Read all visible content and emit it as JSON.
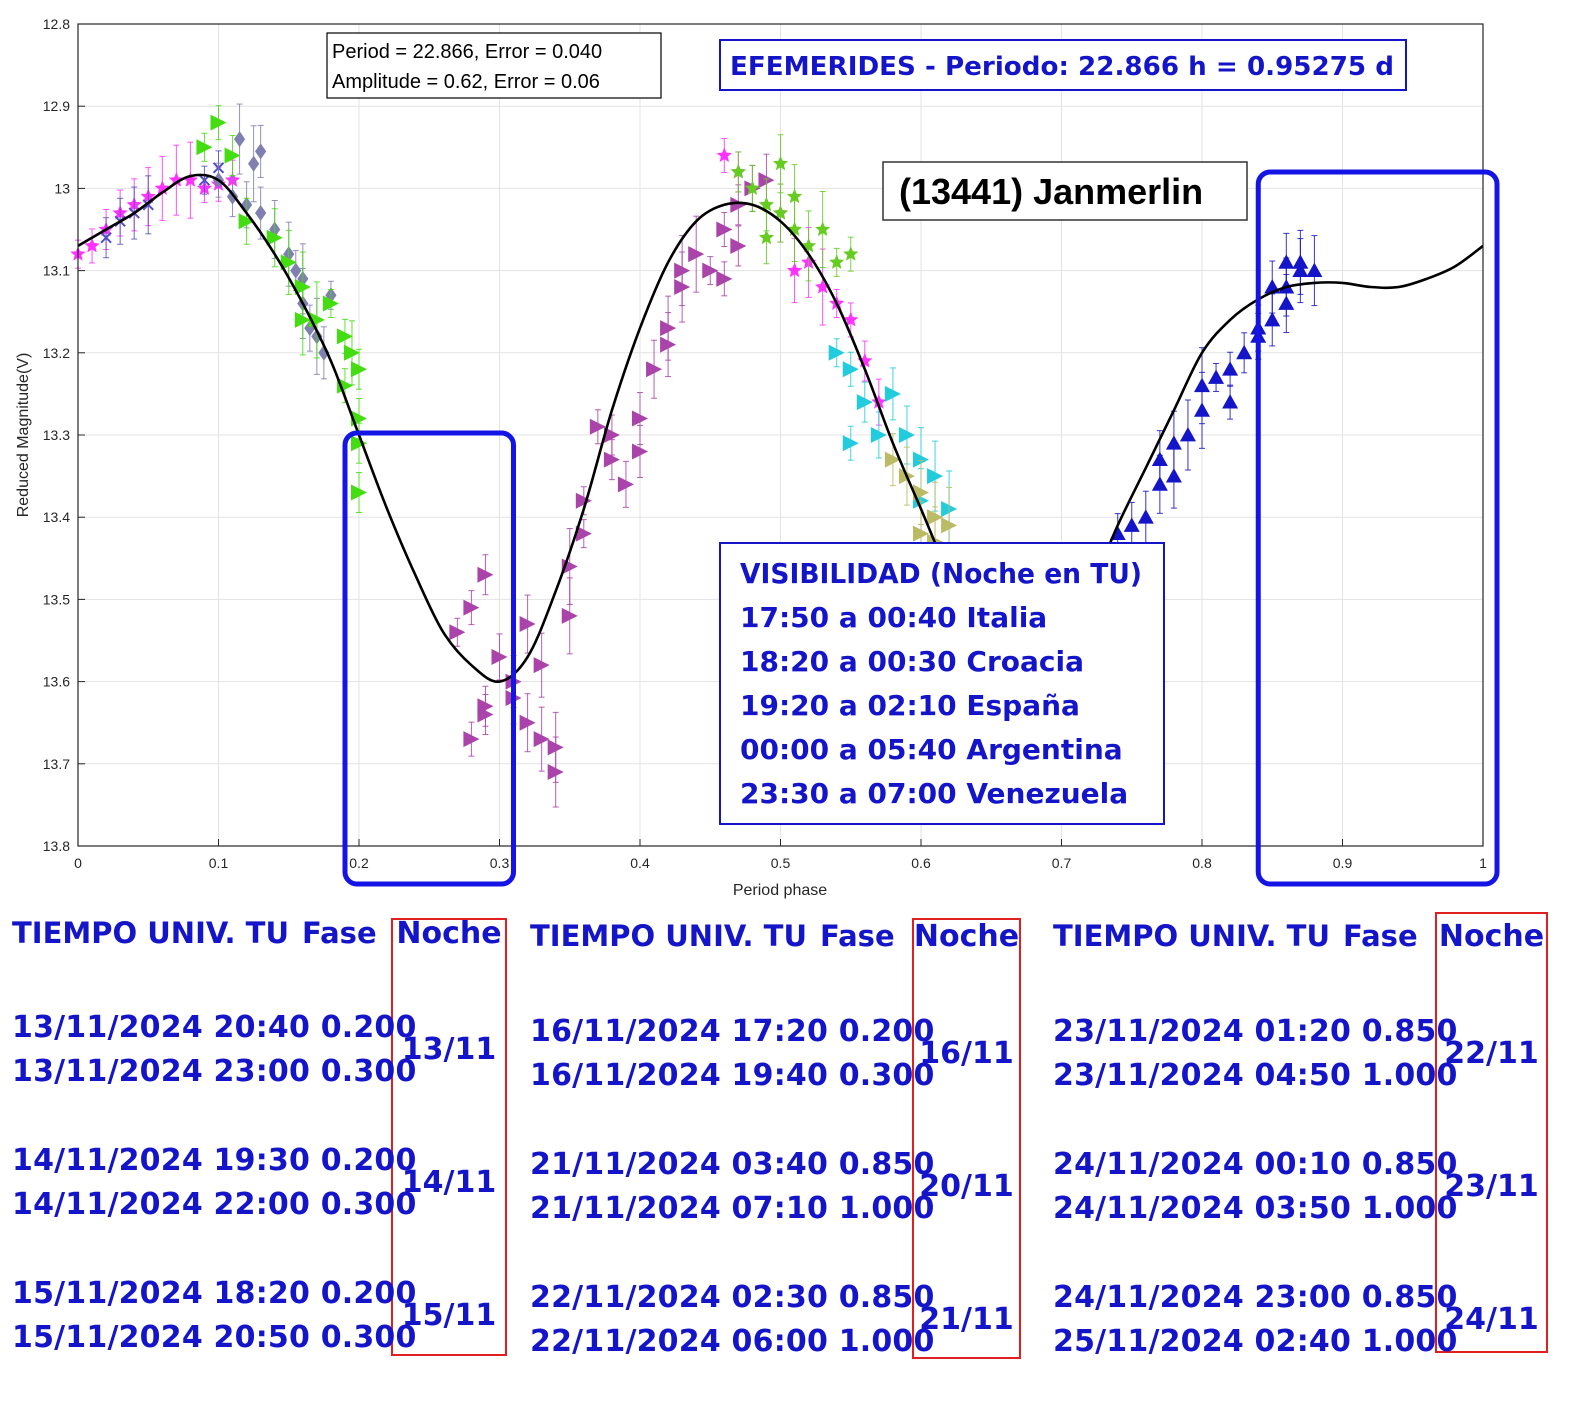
{
  "chart_data": {
    "type": "scatter",
    "xlabel": "Period phase",
    "ylabel": "Reduced Magnitude(V)",
    "xlim": [
      0,
      1
    ],
    "ylim": [
      12.8,
      13.8
    ],
    "y_reversed": true,
    "grid": true,
    "xticks": [
      "0",
      "0.1",
      "0.2",
      "0.3",
      "0.4",
      "0.5",
      "0.6",
      "0.7",
      "0.8",
      "0.9",
      "1"
    ],
    "yticks": [
      "12.8",
      "12.9",
      "13",
      "13.1",
      "13.2",
      "13.3",
      "13.4",
      "13.5",
      "13.6",
      "13.7",
      "13.8"
    ],
    "fit_box": {
      "line1": "Period =  22.866, Error = 0.040",
      "line2": "Amplitude = 0.62, Error = 0.06"
    },
    "ephem_title": "EFEMERIDES - Periodo: 22.866 h = 0.95275 d",
    "object_name": "(13441) Janmerlin",
    "visibility": {
      "title": "VISIBILIDAD (Noche en TU)",
      "lines": [
        "17:50 a 00:40 Italia",
        "18:20 a 00:30 Croacia",
        "19:20 a 02:10 España",
        "00:00 a 05:40 Argentina",
        "23:30 a 07:00 Venezuela"
      ]
    },
    "highlight_windows": [
      [
        0.2,
        0.3
      ],
      [
        0.85,
        1.0
      ]
    ],
    "fit_curve": {
      "x": [
        0.0,
        0.02,
        0.04,
        0.06,
        0.08,
        0.1,
        0.12,
        0.14,
        0.16,
        0.18,
        0.2,
        0.22,
        0.24,
        0.26,
        0.28,
        0.3,
        0.32,
        0.34,
        0.36,
        0.38,
        0.4,
        0.42,
        0.44,
        0.46,
        0.48,
        0.5,
        0.52,
        0.54,
        0.56,
        0.58,
        0.6,
        0.62,
        0.64,
        0.66,
        0.68,
        0.7,
        0.72,
        0.74,
        0.76,
        0.78,
        0.8,
        0.82,
        0.84,
        0.86,
        0.88,
        0.9,
        0.92,
        0.94,
        0.96,
        0.98,
        1.0
      ],
      "y": [
        13.07,
        13.05,
        13.03,
        13.005,
        12.985,
        12.99,
        13.03,
        13.08,
        13.14,
        13.21,
        13.3,
        13.39,
        13.47,
        13.54,
        13.58,
        13.6,
        13.57,
        13.49,
        13.39,
        13.27,
        13.17,
        13.09,
        13.04,
        13.02,
        13.02,
        13.04,
        13.08,
        13.14,
        13.22,
        13.31,
        13.39,
        13.47,
        13.53,
        13.56,
        13.57,
        13.55,
        13.49,
        13.41,
        13.34,
        13.27,
        13.2,
        13.16,
        13.135,
        13.12,
        13.115,
        13.115,
        13.12,
        13.12,
        13.11,
        13.095,
        13.07
      ]
    },
    "series": [
      {
        "color": "#ff33ff",
        "marker": "star",
        "points": [
          [
            0.0,
            13.08
          ],
          [
            0.01,
            13.07
          ],
          [
            0.02,
            13.05
          ],
          [
            0.03,
            13.03
          ],
          [
            0.04,
            13.02
          ],
          [
            0.05,
            13.01
          ],
          [
            0.06,
            13.0
          ],
          [
            0.07,
            12.99
          ],
          [
            0.08,
            12.99
          ],
          [
            0.09,
            13.0
          ],
          [
            0.1,
            12.995
          ],
          [
            0.11,
            12.99
          ],
          [
            0.46,
            12.96
          ],
          [
            0.47,
            12.98
          ],
          [
            0.5,
            13.03
          ],
          [
            0.51,
            13.1
          ],
          [
            0.52,
            13.09
          ],
          [
            0.53,
            13.12
          ],
          [
            0.54,
            13.14
          ],
          [
            0.55,
            13.16
          ],
          [
            0.56,
            13.21
          ],
          [
            0.57,
            13.26
          ]
        ]
      },
      {
        "color": "#5050c0",
        "marker": "x",
        "points": [
          [
            0.02,
            13.06
          ],
          [
            0.03,
            13.04
          ],
          [
            0.04,
            13.03
          ],
          [
            0.05,
            13.02
          ],
          [
            0.09,
            12.99
          ],
          [
            0.1,
            12.975
          ]
        ]
      },
      {
        "color": "#7f7fb0",
        "marker": "diamond",
        "points": [
          [
            0.1,
            12.99
          ],
          [
            0.11,
            13.01
          ],
          [
            0.115,
            12.94
          ],
          [
            0.12,
            13.02
          ],
          [
            0.125,
            12.97
          ],
          [
            0.13,
            13.03
          ],
          [
            0.13,
            12.955
          ],
          [
            0.14,
            13.05
          ],
          [
            0.15,
            13.08
          ],
          [
            0.155,
            13.1
          ],
          [
            0.16,
            13.11
          ],
          [
            0.16,
            13.14
          ],
          [
            0.165,
            13.17
          ],
          [
            0.17,
            13.18
          ],
          [
            0.175,
            13.2
          ],
          [
            0.18,
            13.13
          ]
        ]
      },
      {
        "color": "#44dd11",
        "marker": "triangle-right",
        "points": [
          [
            0.09,
            12.95
          ],
          [
            0.1,
            12.92
          ],
          [
            0.11,
            12.96
          ],
          [
            0.12,
            13.04
          ],
          [
            0.14,
            13.06
          ],
          [
            0.15,
            13.09
          ],
          [
            0.16,
            13.12
          ],
          [
            0.16,
            13.16
          ],
          [
            0.17,
            13.16
          ],
          [
            0.18,
            13.14
          ],
          [
            0.19,
            13.18
          ],
          [
            0.195,
            13.2
          ],
          [
            0.2,
            13.22
          ],
          [
            0.19,
            13.24
          ],
          [
            0.2,
            13.28
          ],
          [
            0.2,
            13.31
          ],
          [
            0.2,
            13.37
          ]
        ]
      },
      {
        "color": "#aa44aa",
        "marker": "triangle-right",
        "points": [
          [
            0.27,
            13.54
          ],
          [
            0.28,
            13.51
          ],
          [
            0.29,
            13.47
          ],
          [
            0.28,
            13.67
          ],
          [
            0.29,
            13.63
          ],
          [
            0.29,
            13.64
          ],
          [
            0.3,
            13.57
          ],
          [
            0.31,
            13.6
          ],
          [
            0.31,
            13.62
          ],
          [
            0.32,
            13.53
          ],
          [
            0.32,
            13.65
          ],
          [
            0.33,
            13.58
          ],
          [
            0.33,
            13.67
          ],
          [
            0.34,
            13.71
          ],
          [
            0.34,
            13.68
          ],
          [
            0.35,
            13.52
          ],
          [
            0.35,
            13.46
          ],
          [
            0.36,
            13.42
          ],
          [
            0.36,
            13.38
          ],
          [
            0.37,
            13.29
          ],
          [
            0.38,
            13.33
          ],
          [
            0.38,
            13.3
          ],
          [
            0.39,
            13.36
          ],
          [
            0.4,
            13.28
          ],
          [
            0.4,
            13.32
          ],
          [
            0.41,
            13.22
          ],
          [
            0.42,
            13.19
          ],
          [
            0.42,
            13.17
          ],
          [
            0.43,
            13.12
          ],
          [
            0.43,
            13.1
          ],
          [
            0.44,
            13.08
          ],
          [
            0.45,
            13.1
          ],
          [
            0.46,
            13.05
          ],
          [
            0.47,
            13.02
          ],
          [
            0.48,
            13.0
          ],
          [
            0.49,
            12.99
          ],
          [
            0.47,
            13.07
          ],
          [
            0.46,
            13.11
          ]
        ]
      },
      {
        "color": "#66cc22",
        "marker": "star",
        "points": [
          [
            0.47,
            12.98
          ],
          [
            0.48,
            13.0
          ],
          [
            0.49,
            13.02
          ],
          [
            0.5,
            13.03
          ],
          [
            0.51,
            13.05
          ],
          [
            0.52,
            13.07
          ],
          [
            0.53,
            13.05
          ],
          [
            0.54,
            13.09
          ],
          [
            0.55,
            13.08
          ],
          [
            0.5,
            12.97
          ],
          [
            0.49,
            13.06
          ],
          [
            0.51,
            13.01
          ]
        ]
      },
      {
        "color": "#22ccdd",
        "marker": "triangle-right",
        "points": [
          [
            0.54,
            13.2
          ],
          [
            0.55,
            13.22
          ],
          [
            0.56,
            13.26
          ],
          [
            0.55,
            13.31
          ],
          [
            0.57,
            13.3
          ],
          [
            0.58,
            13.25
          ],
          [
            0.59,
            13.3
          ],
          [
            0.6,
            13.33
          ],
          [
            0.6,
            13.38
          ],
          [
            0.61,
            13.35
          ],
          [
            0.62,
            13.39
          ]
        ]
      },
      {
        "color": "#bbbb66",
        "marker": "triangle-right",
        "points": [
          [
            0.58,
            13.33
          ],
          [
            0.59,
            13.35
          ],
          [
            0.6,
            13.37
          ],
          [
            0.61,
            13.4
          ],
          [
            0.62,
            13.41
          ],
          [
            0.6,
            13.42
          ],
          [
            0.61,
            13.43
          ]
        ]
      },
      {
        "color": "#1414c8",
        "marker": "triangle-up",
        "points": [
          [
            0.74,
            13.42
          ],
          [
            0.75,
            13.41
          ],
          [
            0.76,
            13.4
          ],
          [
            0.77,
            13.36
          ],
          [
            0.77,
            13.33
          ],
          [
            0.78,
            13.31
          ],
          [
            0.79,
            13.3
          ],
          [
            0.78,
            13.35
          ],
          [
            0.8,
            13.27
          ],
          [
            0.8,
            13.24
          ],
          [
            0.81,
            13.23
          ],
          [
            0.82,
            13.26
          ],
          [
            0.82,
            13.22
          ],
          [
            0.83,
            13.2
          ],
          [
            0.84,
            13.18
          ],
          [
            0.84,
            13.17
          ],
          [
            0.85,
            13.16
          ],
          [
            0.86,
            13.14
          ],
          [
            0.86,
            13.12
          ],
          [
            0.87,
            13.1
          ],
          [
            0.87,
            13.09
          ],
          [
            0.88,
            13.1
          ],
          [
            0.85,
            13.12
          ],
          [
            0.86,
            13.09
          ]
        ]
      }
    ]
  },
  "ephemerides": {
    "head_time": "TIEMPO UNIV. TU",
    "head_phase": "Fase",
    "head_night": "Noche",
    "columns": [
      {
        "groups": [
          {
            "rows": [
              "13/11/2024  20:40 0.200",
              "13/11/2024  23:00 0.300"
            ],
            "night": "13/11"
          },
          {
            "rows": [
              "14/11/2024  19:30 0.200",
              "14/11/2024  22:00 0.300"
            ],
            "night": "14/11"
          },
          {
            "rows": [
              "15/11/2024  18:20 0.200",
              "15/11/2024  20:50 0.300"
            ],
            "night": "15/11"
          }
        ]
      },
      {
        "groups": [
          {
            "rows": [
              "16/11/2024  17:20 0.200",
              "16/11/2024  19:40 0.300"
            ],
            "night": "16/11"
          },
          {
            "rows": [
              "21/11/2024  03:40 0.850",
              "21/11/2024  07:10 1.000"
            ],
            "night": "20/11"
          },
          {
            "rows": [
              "22/11/2024  02:30 0.850",
              "22/11/2024  06:00 1.000"
            ],
            "night": "21/11"
          }
        ]
      },
      {
        "groups": [
          {
            "rows": [
              "23/11/2024  01:20 0.850",
              "23/11/2024  04:50 1.000"
            ],
            "night": "22/11"
          },
          {
            "rows": [
              "24/11/2024  00:10 0.850",
              "24/11/2024  03:50 1.000"
            ],
            "night": "23/11"
          },
          {
            "rows": [
              "24/11/2024  23:00 0.850",
              "25/11/2024  02:40 1.000"
            ],
            "night": "24/11"
          }
        ]
      }
    ]
  }
}
